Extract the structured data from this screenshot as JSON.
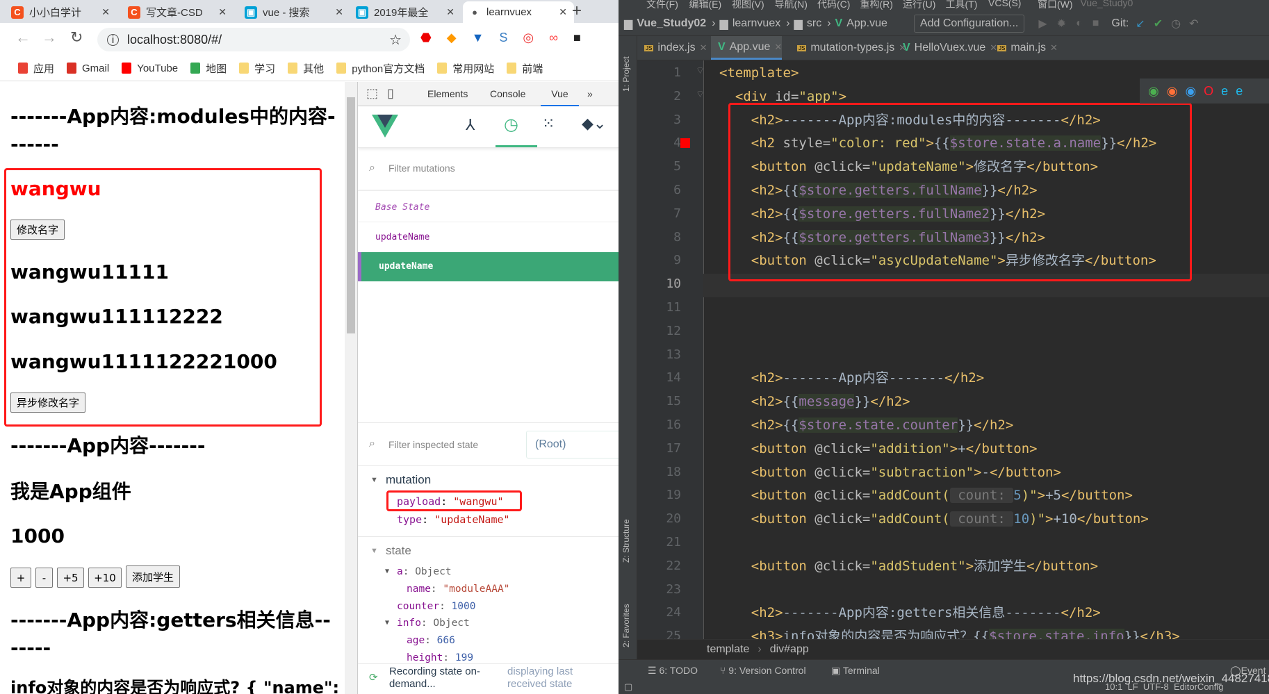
{
  "browser": {
    "tabs": [
      {
        "title": "小小白学计",
        "icon": "csdn-icon",
        "color": "#f4511e",
        "glyph": "C"
      },
      {
        "title": "写文章-CSD",
        "icon": "csdn-icon",
        "color": "#f4511e",
        "glyph": "C"
      },
      {
        "title": "vue - 搜索",
        "icon": "bilibili-icon",
        "color": "#00a1d6",
        "glyph": "▣"
      },
      {
        "title": "2019年最全",
        "icon": "bilibili-icon",
        "color": "#00a1d6",
        "glyph": "▣"
      },
      {
        "title": "learnvuex",
        "icon": "globe-icon",
        "color": "#555",
        "glyph": "●"
      }
    ],
    "url": "localhost:8080/#/",
    "bookmarks": [
      {
        "label": "应用",
        "color": "#e94235"
      },
      {
        "label": "Gmail",
        "color": "#d93025"
      },
      {
        "label": "YouTube",
        "color": "#ff0000"
      },
      {
        "label": "地图",
        "color": "#34a853"
      },
      {
        "label": "学习",
        "color": "#f8d775"
      },
      {
        "label": "其他",
        "color": "#f8d775"
      },
      {
        "label": "python官方文档",
        "color": "#f8d775"
      },
      {
        "label": "常用网站",
        "color": "#f8d775"
      },
      {
        "label": "前端",
        "color": "#f8d775"
      }
    ]
  },
  "page": {
    "h_modules": "-------App内容:modules中的内容-------",
    "name_red": "wangwu",
    "btn_update": "修改名字",
    "full1": "wangwu11111",
    "full2": "wangwu111112222",
    "full3": "wangwu1111122221000",
    "btn_async": "异步修改名字",
    "h_app": "-------App内容-------",
    "message": "我是App组件",
    "counter": "1000",
    "buttons": [
      "+",
      "-",
      "+5",
      "+10",
      "添加学生"
    ],
    "h_getters": "-------App内容:getters相关信息-------",
    "info_line": "info对象的内容是否为响应式? { \"name\":"
  },
  "devtools": {
    "tabs": [
      "Elements",
      "Console",
      "Vue",
      "»"
    ],
    "active_tab": "Vue",
    "filter_mutations": "Filter mutations",
    "mutations": [
      "Base State",
      "updateName",
      "updateName"
    ],
    "filter_state": "Filter inspected state",
    "root": "(Root)",
    "mutation_label": "mutation",
    "payload_key": "payload",
    "payload_val": "\"wangwu\"",
    "type_key": "type",
    "type_val": "\"updateName\"",
    "state_label": "state",
    "state_rows": [
      {
        "k": "a",
        "v": "Object",
        "kind": "obj",
        "indent": 1,
        "arrow": true
      },
      {
        "k": "name",
        "v": "\"moduleAAA\"",
        "kind": "str",
        "indent": 2
      },
      {
        "k": "counter",
        "v": "1000",
        "kind": "num",
        "indent": 1
      },
      {
        "k": "info",
        "v": "Object",
        "kind": "obj",
        "indent": 1,
        "arrow": true
      },
      {
        "k": "age",
        "v": "666",
        "kind": "num",
        "indent": 2
      },
      {
        "k": "height",
        "v": "199",
        "kind": "num",
        "indent": 2
      }
    ],
    "recording": "Recording state on-demand...",
    "displaying": "displaying last received state",
    "accent": "#41b883"
  },
  "ide": {
    "menu": [
      "文件(F)",
      "编辑(E)",
      "视图(V)",
      "导航(N)",
      "代码(C)",
      "重构(R)",
      "运行(U)",
      "工具(T)",
      "VCS(S)",
      "窗口(W)",
      "Vue_Study0"
    ],
    "nav": [
      "Vue_Study02",
      "learnvuex",
      "src",
      "App.vue"
    ],
    "add_config": "Add Configuration...",
    "git": "Git:",
    "tabs": [
      {
        "label": "index.js",
        "icon": "js"
      },
      {
        "label": "App.vue",
        "icon": "vue",
        "active": true
      },
      {
        "label": "mutation-types.js",
        "icon": "js"
      },
      {
        "label": "HelloVuex.vue",
        "icon": "vue"
      },
      {
        "label": "main.js",
        "icon": "js"
      }
    ],
    "side_tools": [
      "1: Project",
      "Z: Structure",
      "2: Favorites"
    ],
    "current_line": 10,
    "lines": [
      [
        [
          "tag",
          "<template>"
        ]
      ],
      [
        [
          "tag",
          "  <div "
        ],
        [
          "attr",
          "id="
        ],
        [
          "str",
          "\"app\""
        ],
        [
          "tag",
          ">"
        ]
      ],
      [
        [
          "tag",
          "    <h2>"
        ],
        [
          "text",
          "-------App内容:modules中的内容-------"
        ],
        [
          "tag",
          "</h2>"
        ]
      ],
      [
        [
          "tag",
          "    <h2 "
        ],
        [
          "attr",
          "style="
        ],
        [
          "str",
          "\"color: red\""
        ],
        [
          "tag",
          ">"
        ],
        [
          "text",
          "{{"
        ],
        [
          "interp",
          "$store.state.a.name"
        ],
        [
          "text",
          "}}"
        ],
        [
          "tag",
          "</h2>"
        ]
      ],
      [
        [
          "tag",
          "    <button "
        ],
        [
          "attr",
          "@click="
        ],
        [
          "str",
          "\"updateName\""
        ],
        [
          "tag",
          ">"
        ],
        [
          "text",
          "修改名字"
        ],
        [
          "tag",
          "</button>"
        ]
      ],
      [
        [
          "tag",
          "    <h2>"
        ],
        [
          "text",
          "{{"
        ],
        [
          "interp",
          "$store.getters.fullName"
        ],
        [
          "text",
          "}}"
        ],
        [
          "tag",
          "</h2>"
        ]
      ],
      [
        [
          "tag",
          "    <h2>"
        ],
        [
          "text",
          "{{"
        ],
        [
          "interp",
          "$store.getters.fullName2"
        ],
        [
          "text",
          "}}"
        ],
        [
          "tag",
          "</h2>"
        ]
      ],
      [
        [
          "tag",
          "    <h2>"
        ],
        [
          "text",
          "{{"
        ],
        [
          "interp",
          "$store.getters.fullName3"
        ],
        [
          "text",
          "}}"
        ],
        [
          "tag",
          "</h2>"
        ]
      ],
      [
        [
          "tag",
          "    <button "
        ],
        [
          "attr",
          "@click="
        ],
        [
          "str",
          "\"asycUpdateName\""
        ],
        [
          "tag",
          ">"
        ],
        [
          "text",
          "异步修改名字"
        ],
        [
          "tag",
          "</button>"
        ]
      ],
      [],
      [],
      [],
      [],
      [
        [
          "tag",
          "    <h2>"
        ],
        [
          "text",
          "-------App内容-------"
        ],
        [
          "tag",
          "</h2>"
        ]
      ],
      [
        [
          "tag",
          "    <h2>"
        ],
        [
          "text",
          "{{"
        ],
        [
          "interp",
          "message"
        ],
        [
          "text",
          "}}"
        ],
        [
          "tag",
          "</h2>"
        ]
      ],
      [
        [
          "tag",
          "    <h2>"
        ],
        [
          "text",
          "{{"
        ],
        [
          "interp",
          "$store.state.counter"
        ],
        [
          "text",
          "}}"
        ],
        [
          "tag",
          "</h2>"
        ]
      ],
      [
        [
          "tag",
          "    <button "
        ],
        [
          "attr",
          "@click="
        ],
        [
          "str",
          "\"addition\""
        ],
        [
          "tag",
          ">"
        ],
        [
          "text",
          "+"
        ],
        [
          "tag",
          "</button>"
        ]
      ],
      [
        [
          "tag",
          "    <button "
        ],
        [
          "attr",
          "@click="
        ],
        [
          "str",
          "\"subtraction\""
        ],
        [
          "tag",
          ">"
        ],
        [
          "text",
          "-"
        ],
        [
          "tag",
          "</button>"
        ]
      ],
      [
        [
          "tag",
          "    <button "
        ],
        [
          "attr",
          "@click="
        ],
        [
          "str",
          "\"addCount("
        ],
        [
          "hint",
          " count: "
        ],
        [
          "num",
          "5"
        ],
        [
          "str",
          ")\""
        ],
        [
          "tag",
          ">"
        ],
        [
          "text",
          "+5"
        ],
        [
          "tag",
          "</button>"
        ]
      ],
      [
        [
          "tag",
          "    <button "
        ],
        [
          "attr",
          "@click="
        ],
        [
          "str",
          "\"addCount("
        ],
        [
          "hint",
          " count: "
        ],
        [
          "num",
          "10"
        ],
        [
          "str",
          ")\""
        ],
        [
          "tag",
          ">"
        ],
        [
          "text",
          "+10"
        ],
        [
          "tag",
          "</button>"
        ]
      ],
      [],
      [
        [
          "tag",
          "    <button "
        ],
        [
          "attr",
          "@click="
        ],
        [
          "str",
          "\"addStudent\""
        ],
        [
          "tag",
          ">"
        ],
        [
          "text",
          "添加学生"
        ],
        [
          "tag",
          "</button>"
        ]
      ],
      [],
      [
        [
          "tag",
          "    <h2>"
        ],
        [
          "text",
          "-------App内容:getters相关信息-------"
        ],
        [
          "tag",
          "</h2>"
        ]
      ],
      [
        [
          "tag",
          "    <h3>"
        ],
        [
          "text",
          "info对象的内容是否为响应式？{{"
        ],
        [
          "interp",
          "$store.state.info"
        ],
        [
          "text",
          "}}"
        ],
        [
          "tag",
          "</h3>"
        ]
      ]
    ],
    "breadcrumb": [
      "template",
      "div#app"
    ],
    "tool_windows": [
      "6: TODO",
      "9: Version Control",
      "Terminal"
    ],
    "event_log": "Event",
    "status": "10:1  LF  UTF-8  EditorConfig",
    "watermark": "https://blog.csdn.net/weixin_44827418",
    "annotation_color": "#ff1a1a"
  }
}
